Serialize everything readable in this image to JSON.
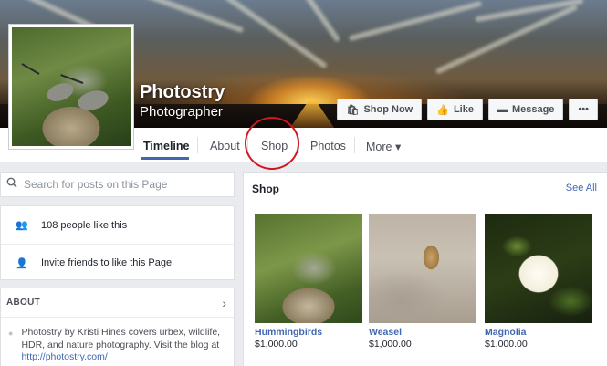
{
  "page": {
    "name": "Photostry",
    "category": "Photographer"
  },
  "actions": {
    "shop_now": "Shop Now",
    "like": "Like",
    "message": "Message",
    "more": "•••"
  },
  "tabs": [
    {
      "label": "Timeline",
      "active": true
    },
    {
      "label": "About"
    },
    {
      "label": "Shop"
    },
    {
      "label": "Photos"
    },
    {
      "label": "More ▾"
    }
  ],
  "search": {
    "placeholder": "Search for posts on this Page"
  },
  "sidebar": {
    "likes": "108 people like this",
    "invite": "Invite friends to like this Page"
  },
  "about": {
    "heading": "ABOUT",
    "text": "Photostry by Kristi Hines covers urbex, wildlife, HDR, and nature photography. Visit the blog at",
    "link": "http://photostry.com/"
  },
  "shop": {
    "heading": "Shop",
    "see_all": "See All",
    "products": [
      {
        "name": "Hummingbirds",
        "price": "$1,000.00"
      },
      {
        "name": "Weasel",
        "price": "$1,000.00"
      },
      {
        "name": "Magnolia",
        "price": "$1,000.00"
      }
    ]
  },
  "colors": {
    "link": "#4267b2",
    "highlight_circle": "#d0161e"
  }
}
